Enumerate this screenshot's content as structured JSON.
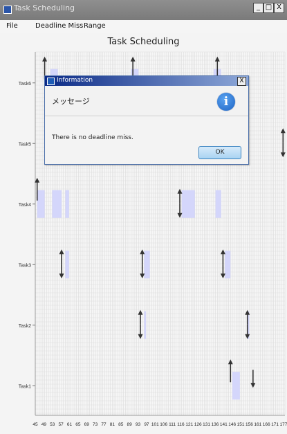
{
  "window": {
    "title": "Task Scheduling",
    "buttons": [
      "_",
      "□",
      "X"
    ]
  },
  "menu": {
    "items": [
      "File",
      "Deadline Miss",
      "Range"
    ]
  },
  "chart_data": {
    "type": "bar",
    "title": "Task Scheduling",
    "xlabel": "",
    "ylabel": "",
    "xlim": [
      45,
      178
    ],
    "x_tick_labels": [
      "45",
      "49",
      "53",
      "57",
      "61",
      "65",
      "69",
      "73",
      "77",
      "81",
      "85",
      "89",
      "93",
      "97",
      "101",
      "106",
      "111",
      "116",
      "121",
      "126",
      "131",
      "136",
      "141",
      "146",
      "151",
      "156",
      "161",
      "166",
      "171",
      "177"
    ],
    "tasks": [
      "Task1",
      "Task2",
      "Task3",
      "Task4",
      "Task5",
      "Task6"
    ],
    "executions": [
      {
        "task": "Task6",
        "start": 53,
        "end": 57
      },
      {
        "task": "Task6",
        "start": 96,
        "end": 100
      },
      {
        "task": "Task6",
        "start": 140,
        "end": 144
      },
      {
        "task": "Task4",
        "start": 46,
        "end": 50
      },
      {
        "task": "Task4",
        "start": 54,
        "end": 59
      },
      {
        "task": "Task4",
        "start": 61,
        "end": 63
      },
      {
        "task": "Task4",
        "start": 123,
        "end": 130
      },
      {
        "task": "Task4",
        "start": 141,
        "end": 144
      },
      {
        "task": "Task3",
        "start": 61,
        "end": 63
      },
      {
        "task": "Task3",
        "start": 103,
        "end": 106
      },
      {
        "task": "Task3",
        "start": 146,
        "end": 149
      },
      {
        "task": "Task2",
        "start": 103,
        "end": 104
      },
      {
        "task": "Task2",
        "start": 158,
        "end": 159
      },
      {
        "task": "Task1",
        "start": 150,
        "end": 154
      }
    ],
    "releases": [
      {
        "task": "Task6",
        "x": 50
      },
      {
        "task": "Task6",
        "x": 97
      },
      {
        "task": "Task6",
        "x": 142
      },
      {
        "task": "Task4",
        "x": 46
      },
      {
        "task": "Task1",
        "x": 149
      }
    ],
    "deadlines": [
      {
        "task": "Task1",
        "x": 161
      }
    ],
    "release_deadlines": [
      {
        "task": "Task5",
        "x": 177
      },
      {
        "task": "Task4",
        "x": 122
      },
      {
        "task": "Task3",
        "x": 59
      },
      {
        "task": "Task3",
        "x": 102
      },
      {
        "task": "Task3",
        "x": 145
      },
      {
        "task": "Task2",
        "x": 101
      },
      {
        "task": "Task2",
        "x": 158
      }
    ]
  },
  "dialog": {
    "title": "Information",
    "close": "X",
    "header": "メッセージ",
    "icon": "info-icon",
    "icon_glyph": "i",
    "message": "There is no deadline miss.",
    "ok_label": "OK"
  }
}
